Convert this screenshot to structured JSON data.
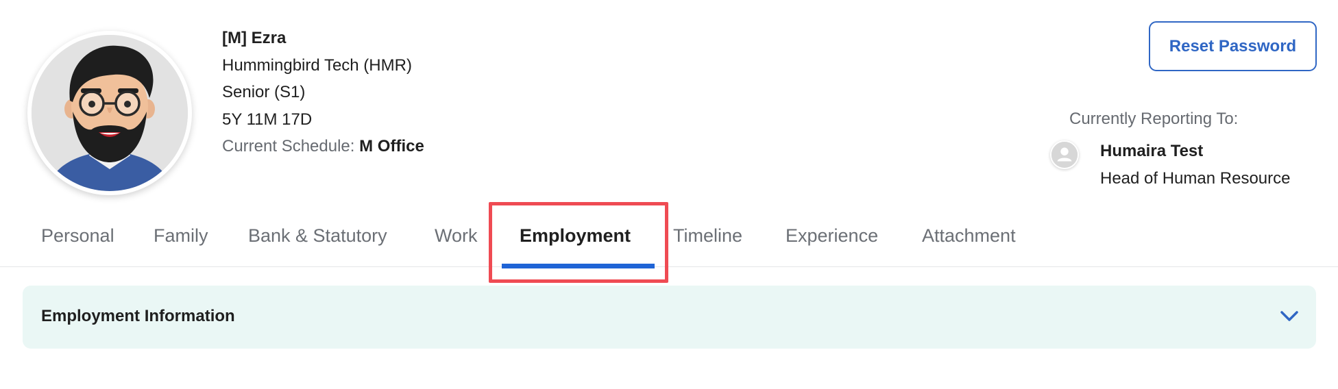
{
  "profile": {
    "name": "[M] Ezra",
    "company": "Hummingbird Tech (HMR)",
    "level": "Senior (S1)",
    "tenure": "5Y 11M 17D",
    "schedule_label": "Current Schedule:",
    "schedule_value": "M Office"
  },
  "actions": {
    "reset_password": "Reset Password"
  },
  "reporting": {
    "label": "Currently Reporting To:",
    "manager_name": "Humaira Test",
    "manager_title": "Head of Human Resource"
  },
  "tabs": [
    {
      "label": "Personal"
    },
    {
      "label": "Family"
    },
    {
      "label": "Bank & Statutory"
    },
    {
      "label": "Work"
    },
    {
      "label": "Employment"
    },
    {
      "label": "Timeline"
    },
    {
      "label": "Experience"
    },
    {
      "label": "Attachment"
    }
  ],
  "active_tab": "Employment",
  "section": {
    "title": "Employment Information"
  },
  "colors": {
    "accent": "#1f64d6",
    "button_border": "#2f66c4",
    "highlight": "#ef4b53",
    "section_bg": "#eaf7f5"
  },
  "icons": {
    "avatar": "cartoon-avatar",
    "manager_avatar": "person-icon",
    "accordion_toggle": "chevron-down-icon"
  }
}
